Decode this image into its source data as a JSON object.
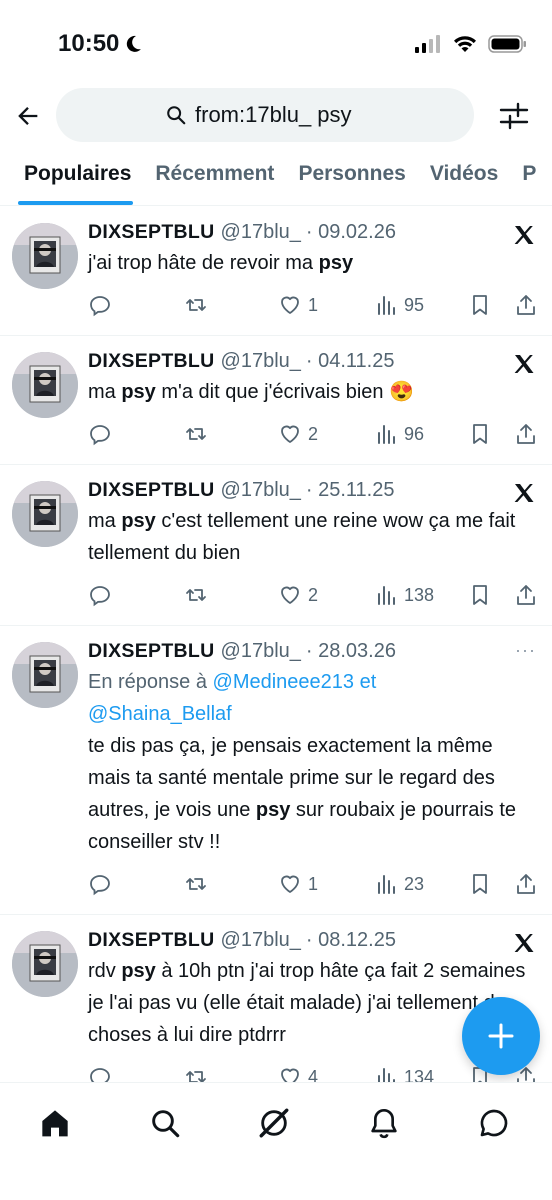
{
  "status_bar": {
    "time": "10:50"
  },
  "search": {
    "query": "from:17blu_ psy"
  },
  "tabs": [
    {
      "label": "Populaires",
      "active": true
    },
    {
      "label": "Récemment"
    },
    {
      "label": "Personnes"
    },
    {
      "label": "Vidéos"
    },
    {
      "label": "P"
    }
  ],
  "tweets": [
    {
      "name": "DIXSEPTBLU",
      "handle": "@17blu_",
      "date": "· 09.02.26",
      "corner": "x-logo",
      "text_parts": [
        "j'ai trop hâte de revoir ma ",
        "psy",
        ""
      ],
      "likes": "1",
      "views": "95"
    },
    {
      "name": "DIXSEPTBLU",
      "handle": "@17blu_",
      "date": "· 04.11.25",
      "corner": "x-logo",
      "text_parts": [
        "ma ",
        "psy",
        " m'a dit que j'écrivais bien 😍"
      ],
      "likes": "2",
      "views": "96"
    },
    {
      "name": "DIXSEPTBLU",
      "handle": "@17blu_",
      "date": "· 25.11.25",
      "corner": "x-logo",
      "text_parts": [
        "ma ",
        "psy",
        " c'est tellement une reine wow ça me fait tellement du bien"
      ],
      "likes": "2",
      "views": "138"
    },
    {
      "name": "DIXSEPTBLU",
      "handle": "@17blu_",
      "date": "· 28.03.26",
      "corner": "more",
      "corner_text": "···",
      "reply_prefix": "En réponse à ",
      "reply_mention_1": "@Medineee213",
      "reply_and": " et",
      "reply_mention_2": "@Shaina_Bellaf",
      "text_parts": [
        "te dis pas ça, je pensais exactement la même mais ta santé mentale prime sur le regard des autres, je vois une ",
        "psy",
        " sur roubaix je pourrais te conseiller stv !!"
      ],
      "likes": "1",
      "views": "23"
    },
    {
      "name": "DIXSEPTBLU",
      "handle": "@17blu_",
      "date": "· 08.12.25",
      "corner": "x-logo",
      "text_parts": [
        "rdv ",
        "psy",
        " à 10h ptn j'ai trop hâte ça fait 2 semaines je l'ai pas vu (elle était malade) j'ai tellement de choses à lui dire ptdrrr"
      ],
      "likes": "4",
      "views": "134"
    }
  ],
  "fab": {
    "icon": "plus-icon"
  },
  "bottom_nav": [
    "home-icon",
    "search-icon",
    "grok-icon",
    "notifications-icon",
    "messages-icon"
  ],
  "colors": {
    "accent": "#1d9bf0",
    "text": "#0f1419",
    "muted": "#536471",
    "search_bg": "#eff3f4"
  }
}
